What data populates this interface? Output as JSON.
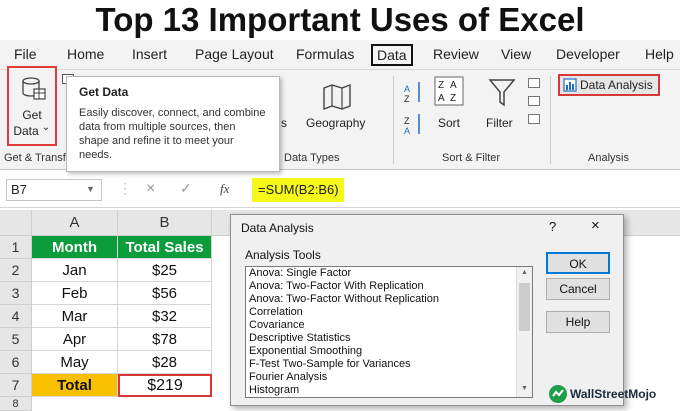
{
  "banner": {
    "title": "Top 13 Important Uses of Excel"
  },
  "menu": {
    "tabs": [
      "File",
      "Home",
      "Insert",
      "Page Layout",
      "Formulas",
      "Data",
      "Review",
      "View",
      "Developer",
      "Help"
    ],
    "active_tab": "Data"
  },
  "ribbon": {
    "get_data": {
      "line1": "Get",
      "line2": "Data",
      "chevron": "⌄"
    },
    "get_transform_group": "Get & Transf",
    "geography": "Geography",
    "stocks_partial": "s",
    "data_types_group": "Data Types",
    "sort": "Sort",
    "filter": "Filter",
    "sort_filter_group": "Sort & Filter",
    "data_analysis": "Data Analysis",
    "analysis_group": "Analysis"
  },
  "tooltip": {
    "title": "Get Data",
    "body": "Easily discover, connect, and combine data from multiple sources, then shape and refine it to meet your needs."
  },
  "formula_bar": {
    "name_box": "B7",
    "cancel": "×",
    "enter": "✓",
    "fx": "fx",
    "formula": "=SUM(B2:B6)"
  },
  "sheet": {
    "columns": [
      "A",
      "B"
    ],
    "rows": [
      "1",
      "2",
      "3",
      "4",
      "5",
      "6",
      "7",
      "8"
    ],
    "headers": [
      "Month",
      "Total Sales"
    ],
    "data": [
      [
        "Jan",
        "$25"
      ],
      [
        "Feb",
        "$56"
      ],
      [
        "Mar",
        "$32"
      ],
      [
        "Apr",
        "$78"
      ],
      [
        "May",
        "$28"
      ]
    ],
    "total_row": [
      "Total",
      "$219"
    ]
  },
  "dialog": {
    "title": "Data Analysis",
    "help": "?",
    "close": "×",
    "list_label": "Analysis Tools",
    "tools": [
      "Anova: Single Factor",
      "Anova: Two-Factor With Replication",
      "Anova: Two-Factor Without Replication",
      "Correlation",
      "Covariance",
      "Descriptive Statistics",
      "Exponential Smoothing",
      "F-Test Two-Sample for Variances",
      "Fourier Analysis",
      "Histogram"
    ],
    "ok": "OK",
    "cancel": "Cancel",
    "help_button": "Help"
  },
  "logo": {
    "text": "WallStreetMojo"
  },
  "colors": {
    "header_green": "#0b9c3b",
    "total_yellow": "#f9c000",
    "highlight_red": "#d93636",
    "formula_yellow": "#f6f81a"
  }
}
